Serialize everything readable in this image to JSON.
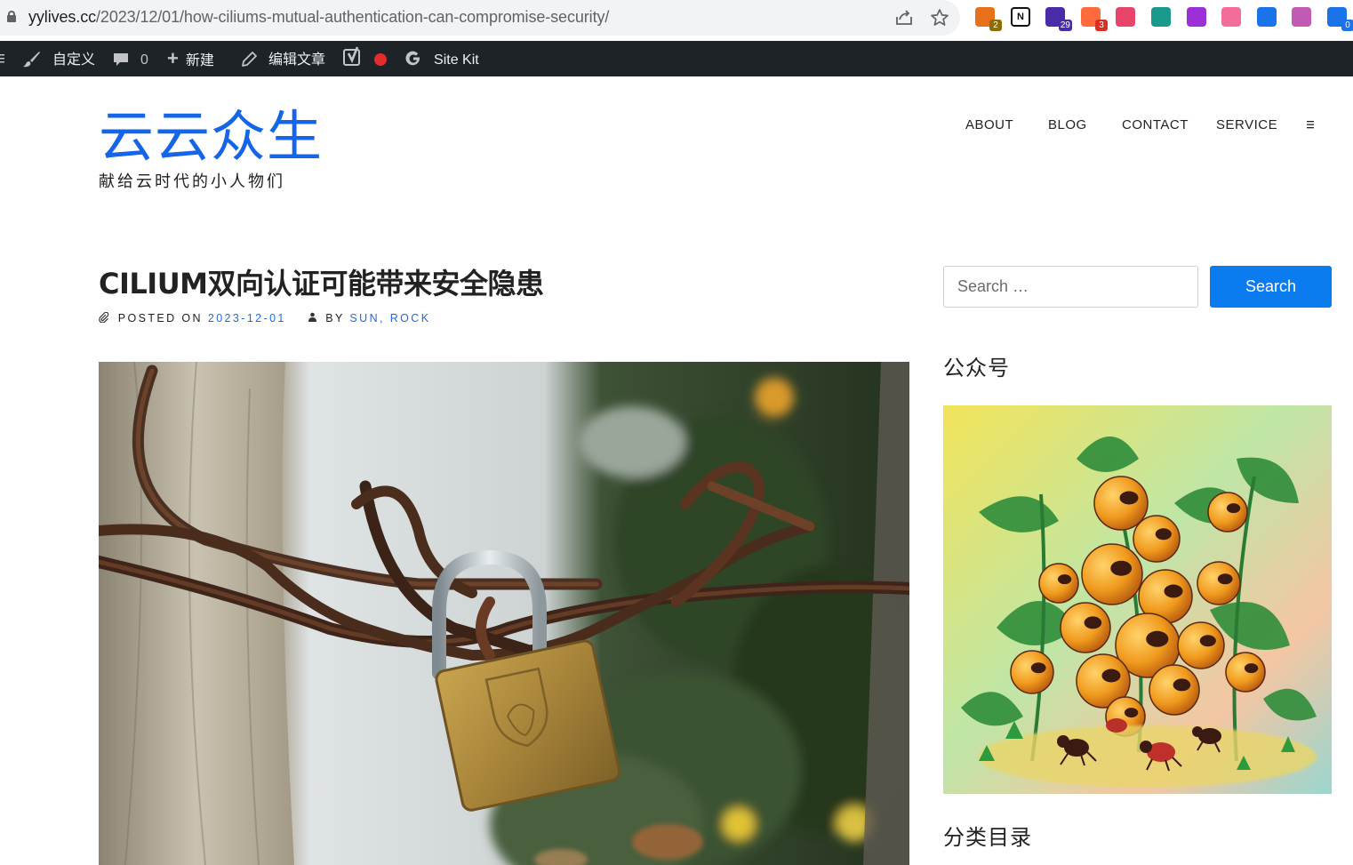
{
  "browser": {
    "url_host": "yylives.cc",
    "url_path": "/2023/12/01/how-ciliums-mutual-authentication-can-compromise-security/",
    "extensions": [
      {
        "name": "colorful-circle-extension",
        "badge": "2",
        "color": "#e8711c",
        "badge_color": "#8d6e00"
      },
      {
        "name": "notion-extension",
        "badge": "",
        "color": "#111111",
        "badge_color": ""
      },
      {
        "name": "graduation-cap-extension",
        "badge": "29",
        "color": "#4a2ca8",
        "badge_color": "#4a2ca8"
      },
      {
        "name": "orange-dots-extension",
        "badge": "3",
        "color": "#ff6b3d",
        "badge_color": "#d93025"
      },
      {
        "name": "translate-extension",
        "badge": "",
        "color": "#e8456b",
        "badge_color": ""
      },
      {
        "name": "teal-pattern-extension",
        "badge": "",
        "color": "#1a9a8a",
        "badge_color": ""
      },
      {
        "name": "purple-circle-extension",
        "badge": "",
        "color": "#9b30d9",
        "badge_color": ""
      },
      {
        "name": "weather-extension",
        "badge": "",
        "color": "#f26d9a",
        "badge_color": ""
      },
      {
        "name": "blue-arrow-extension",
        "badge": "",
        "color": "#1a73e8",
        "badge_color": ""
      },
      {
        "name": "openai-extension",
        "badge": "",
        "color": "#c05ab5",
        "badge_color": ""
      },
      {
        "name": "sync-extension",
        "badge": "0",
        "color": "#1a73e8",
        "badge_color": "#1a73e8"
      }
    ]
  },
  "adminbar": {
    "customize_label": "自定义",
    "comments_count": "0",
    "new_label": "新建",
    "edit_label": "编辑文章",
    "sitekit_label": "Site Kit",
    "status_color": "#e52b2b"
  },
  "site": {
    "title": "云云众生",
    "tagline": "献给云时代的小人物们",
    "nav": [
      "ABOUT",
      "BLOG",
      "CONTACT",
      "SERVICE"
    ]
  },
  "post": {
    "title": "CILIUM双向认证可能带来安全隐患",
    "posted_on_label": "POSTED ON",
    "date": "2023-12-01",
    "by_label": "BY",
    "author": "SUN, ROCK"
  },
  "sidebar": {
    "search_placeholder": "Search …",
    "search_button": "Search",
    "widget_1_title": "公众号",
    "widget_2_title": "分类目录"
  },
  "colors": {
    "accent": "#0a7cf0",
    "site_title": "#1565e8",
    "adminbar_bg": "#1d2327"
  }
}
